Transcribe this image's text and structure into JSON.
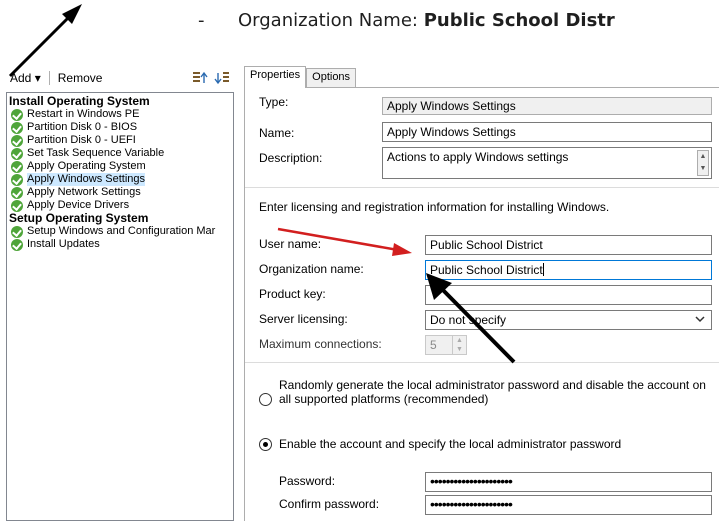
{
  "doc": {
    "dash": "-",
    "label": "Organization Name: ",
    "value": "Public School Distr"
  },
  "left": {
    "toolbar": {
      "add": "Add",
      "add_arrow": "▾",
      "remove": "Remove"
    },
    "tree": [
      {
        "label": "Install Operating System",
        "group": true
      },
      {
        "label": "Restart in Windows PE"
      },
      {
        "label": "Partition Disk 0 - BIOS"
      },
      {
        "label": "Partition Disk 0 - UEFI"
      },
      {
        "label": "Set Task Sequence Variable"
      },
      {
        "label": "Apply Operating System"
      },
      {
        "label": "Apply Windows Settings",
        "selected": true
      },
      {
        "label": "Apply Network Settings"
      },
      {
        "label": "Apply Device Drivers"
      },
      {
        "label": "Setup Operating System",
        "group": true
      },
      {
        "label": "Setup Windows and Configuration Mar"
      },
      {
        "label": "Install Updates"
      }
    ]
  },
  "tabs": {
    "properties": "Properties",
    "options": "Options"
  },
  "props": {
    "type_label": "Type:",
    "type_value": "Apply Windows Settings",
    "name_label": "Name:",
    "name_value": "Apply Windows Settings",
    "desc_label": "Description:",
    "desc_value": "Actions to apply Windows settings",
    "hint": "Enter licensing and registration information for installing Windows.",
    "user_label": "User name:",
    "user_value": "Public School District",
    "org_label": "Organization name:",
    "org_value": "Public School District",
    "key_label": "Product key:",
    "key_value": "",
    "server_label": "Server licensing:",
    "server_value": "Do not specify",
    "maxconn_label": "Maximum connections:",
    "maxconn_value": "5",
    "radio1_text": "Randomly generate the local administrator password and disable the account on all supported platforms (recommended)",
    "radio2_text": "Enable the account and specify the local administrator password",
    "password_label": "Password:",
    "password_value": "•••••••••••••••••••••",
    "confirm_label": "Confirm password:",
    "confirm_value": "•••••••••••••••••••••"
  },
  "colors": {
    "red_arrow": "#d21f1f",
    "black_arrow": "#000000",
    "check": "#4fa53a",
    "selection": "#cce8ff"
  }
}
